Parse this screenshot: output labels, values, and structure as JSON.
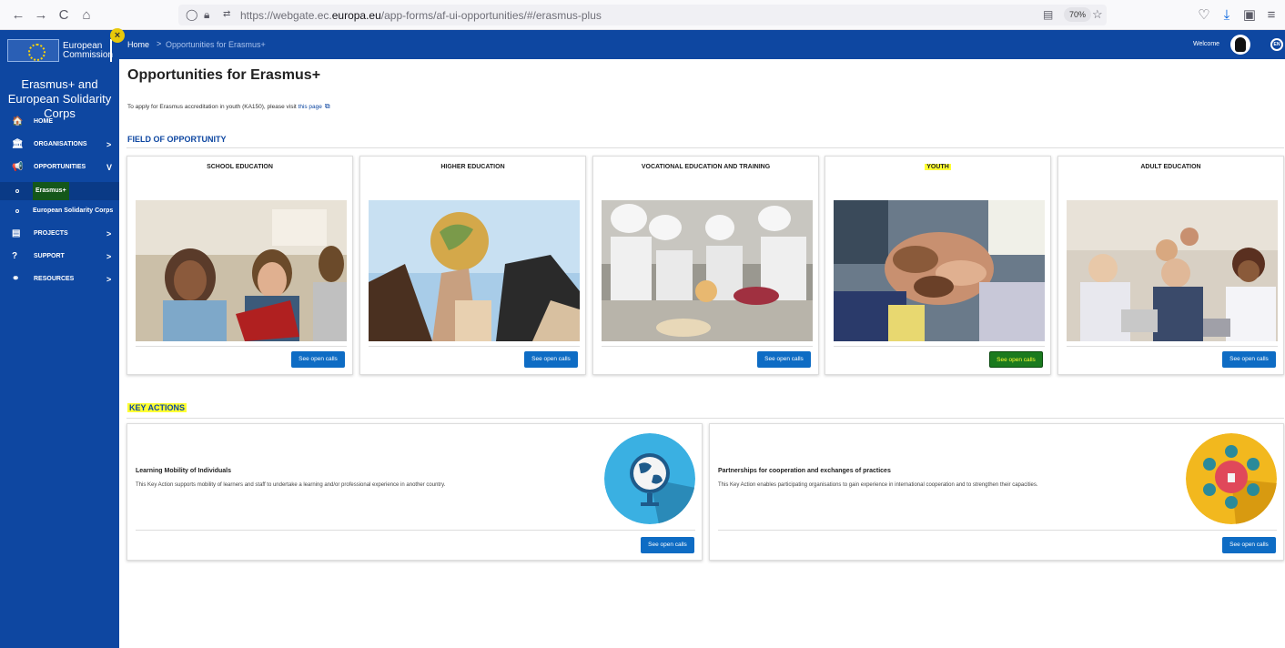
{
  "browser": {
    "url_prefix": "https://webgate.ec.",
    "url_domain": "europa.eu",
    "url_suffix": "/app-forms/af-ui-opportunities/#/erasmus-plus",
    "zoom": "70%",
    "back_icon": "←",
    "forward_icon": "→",
    "reload_icon": "C",
    "home_icon": "⌂",
    "reader_icon": "▤",
    "star_icon": "☆",
    "pocket_icon": "♡",
    "download_icon": "⤓",
    "ext_icon": "▣",
    "menu_icon": "≡"
  },
  "sidebar": {
    "logo_line1": "European",
    "logo_line2": "Commission",
    "title": "Erasmus+ and European Solidarity Corps",
    "items": [
      {
        "label": "HOME",
        "icon": "🏠",
        "chevron": ""
      },
      {
        "label": "ORGANISATIONS",
        "icon": "🏛",
        "chevron": ">"
      },
      {
        "label": "OPPORTUNITIES",
        "icon": "📢",
        "chevron": "v"
      },
      {
        "label": "PROJECTS",
        "icon": "▤",
        "chevron": ">"
      },
      {
        "label": "SUPPORT",
        "icon": "?",
        "chevron": ">"
      },
      {
        "label": "RESOURCES",
        "icon": "⚭",
        "chevron": ">"
      }
    ],
    "subitems": [
      {
        "label": "Erasmus+"
      },
      {
        "label": "European Solidarity Corps"
      }
    ],
    "close_icon": "×"
  },
  "topbar": {
    "home": "Home",
    "separator": ">",
    "current": "Opportunities for Erasmus+",
    "welcome": "Welcome",
    "lang": "EN"
  },
  "main": {
    "title": "Opportunities for Erasmus+",
    "intro_text": "To apply for Erasmus accreditation in youth (KA150), please visit ",
    "intro_link": "this page",
    "field_title": "FIELD OF OPPORTUNITY",
    "key_title": "KEY ACTIONS",
    "fields": [
      {
        "title": "SCHOOL EDUCATION",
        "button": "See open calls"
      },
      {
        "title": "HIGHER EDUCATION",
        "button": "See open calls"
      },
      {
        "title": "VOCATIONAL EDUCATION AND TRAINING",
        "button": "See open calls"
      },
      {
        "title": "YOUTH",
        "button": "See open calls"
      },
      {
        "title": "ADULT EDUCATION",
        "button": "See open calls"
      }
    ],
    "key_actions": [
      {
        "title": "Learning Mobility of Individuals",
        "desc": "This Key Action supports mobility of learners and staff to undertake a learning and/or professional experience in another country.",
        "button": "See open calls"
      },
      {
        "title": "Partnerships for cooperation and exchanges of practices",
        "desc": "This Key Action enables participating organisations to gain experience in international cooperation and to strengthen their capacities.",
        "button": "See open calls"
      }
    ]
  }
}
